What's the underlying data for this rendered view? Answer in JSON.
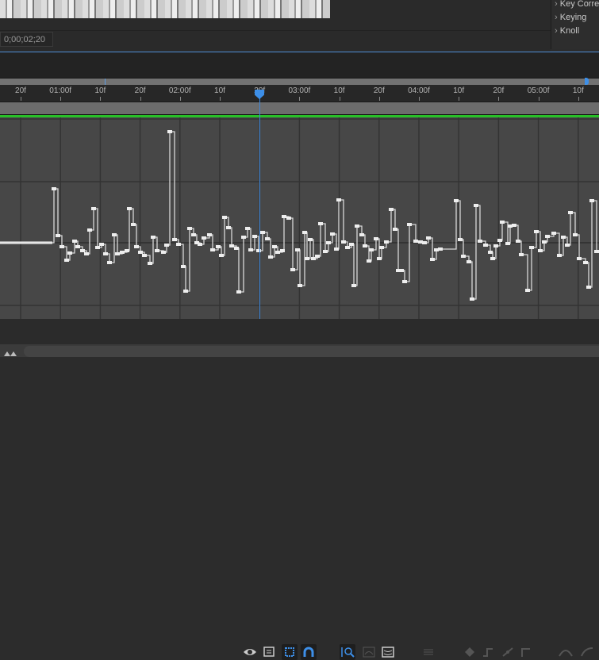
{
  "timecode": "0;00;02;20",
  "effects_panel": {
    "items": [
      "Key Correction",
      "Keying",
      "Knoll"
    ]
  },
  "ruler": {
    "labels": [
      "20f",
      "01:00f",
      "10f",
      "20f",
      "02:00f",
      "10f",
      "20f",
      "03:00f",
      "10f",
      "20f",
      "04:00f",
      "10f",
      "20f",
      "05:00f",
      "10f"
    ]
  },
  "colors": {
    "accent": "#3d8fe8",
    "work_area": "#27c027",
    "curve": "#e6e6e6"
  },
  "toolbar": {
    "icons": [
      "eye-icon",
      "graph-type-icon",
      "transform-box-icon",
      "snap-icon",
      "fit-selection-icon",
      "fit-all-icon",
      "separate-dimensions-icon",
      "edit-keyframe-icon",
      "hold-keyframe-icon",
      "linear-keyframe-icon",
      "auto-bezier-icon",
      "easy-ease-icon",
      "easy-ease-in-icon"
    ]
  }
}
